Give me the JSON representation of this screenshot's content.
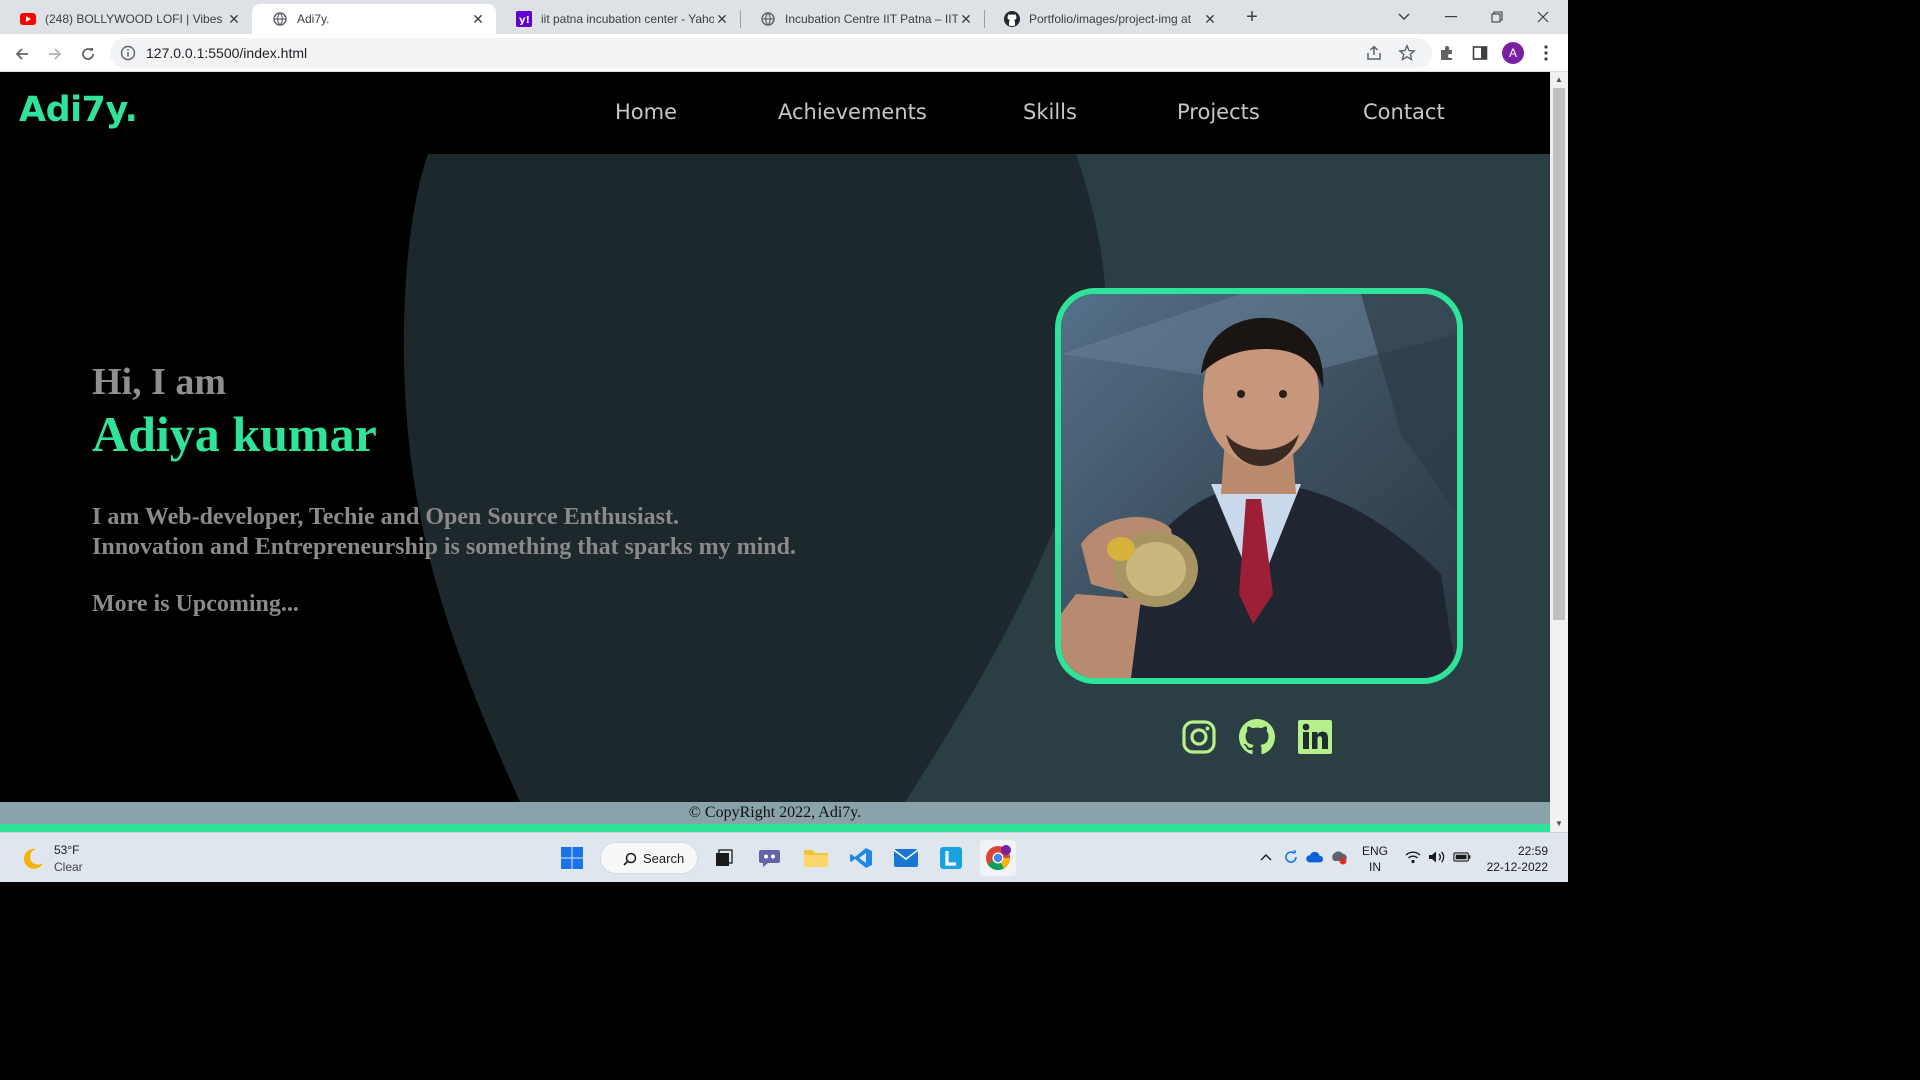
{
  "browser": {
    "tabs": [
      {
        "title": "(248) BOLLYWOOD LOFI | Vibes |",
        "favicon": "youtube-icon",
        "active": false
      },
      {
        "title": "Adi7y.",
        "favicon": "globe-icon",
        "active": true
      },
      {
        "title": "iit patna incubation center - Yaho",
        "favicon": "yahoo-icon",
        "active": false
      },
      {
        "title": "Incubation Centre IIT Patna – IIT P",
        "favicon": "globe-icon",
        "active": false
      },
      {
        "title": "Portfolio/images/project-img at",
        "favicon": "github-icon",
        "active": false
      }
    ],
    "url": "127.0.0.1:5500/index.html",
    "profile_initial": "A"
  },
  "site": {
    "logo": "Adi7y.",
    "nav": [
      "Home",
      "Achievements",
      "Skills",
      "Projects",
      "Contact"
    ],
    "greeting": "Hi, I am",
    "name": "Adiya kumar",
    "bio_line1": "I am Web-developer, Techie and Open Source Enthusiast.",
    "bio_line2": "Innovation and Entrepreneurship is something that sparks my mind.",
    "more": "More is Upcoming...",
    "social": [
      "instagram-icon",
      "github-icon",
      "linkedin-icon"
    ],
    "footer": "© CopyRight 2022, Adi7y.",
    "accent_color": "#2fe39a",
    "social_color": "#b6f08a"
  },
  "taskbar": {
    "weather_temp": "53°F",
    "weather_condition": "Clear",
    "search_label": "Search",
    "lang_line1": "ENG",
    "lang_line2": "IN",
    "time": "22:59",
    "date": "22-12-2022"
  }
}
